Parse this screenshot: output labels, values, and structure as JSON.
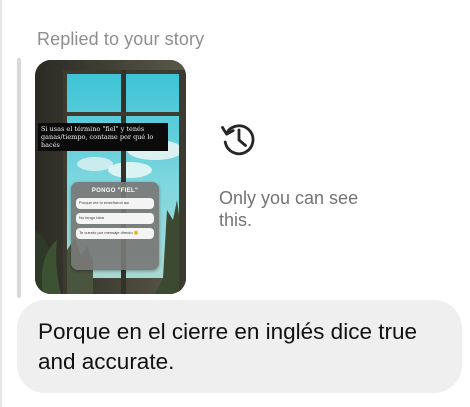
{
  "reply": {
    "label": "Replied to your story"
  },
  "story": {
    "caption": "Si usas el término \"fiel\" y tenés ganas/tiempo, contame por qué lo hacés",
    "poll": {
      "title": "PONGO \"FIEL\"",
      "options": [
        "Porque me lo enseñaron así",
        "No tengo idea",
        "Te cuento por mensaje directo 🙂"
      ]
    }
  },
  "notice": {
    "icon": "history-icon",
    "text": "Only you can see this."
  },
  "message": {
    "text": "Porque en el cierre en inglés dice true and accurate."
  },
  "colors": {
    "bubble": "#efefef",
    "secondary_text": "#8e8e8e",
    "notice_text": "#737373"
  }
}
